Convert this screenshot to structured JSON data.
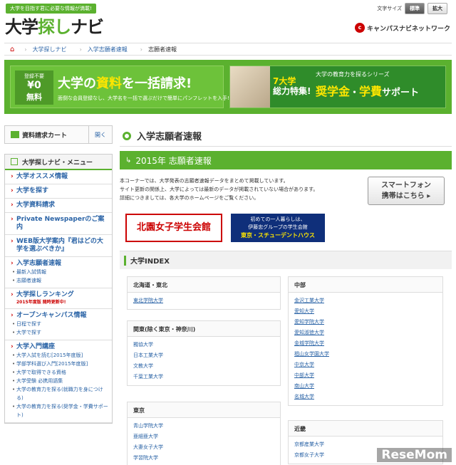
{
  "header": {
    "tagline": "大学を目指す君に必要な情報が満載!",
    "logo_prefix": "大学",
    "logo_mid": "探し",
    "logo_suffix": "ナビ",
    "font_size_label": "文字サイズ",
    "font_standard": "標準",
    "font_large": "拡大",
    "network": "キャンパスナビネットワーク"
  },
  "breadcrumb": {
    "items": [
      "大学探しナビ",
      "入学志願者速報",
      "志願者速報"
    ]
  },
  "banner": {
    "registration": "登録不要",
    "price": "¥0",
    "free": "無料",
    "headline_a": "大学の",
    "headline_b": "資料",
    "headline_c": "を一括請求!",
    "sub": "面倒な会員登録なし、大学名を一括で選ぶだけで簡単にパンフレットを入手!",
    "feature_a": "7大学",
    "feature_b": "総力特集!",
    "series": "大学の教育力を探るシリーズ",
    "scholar_a": "奨学金",
    "scholar_dot": "・",
    "scholar_b": "学費",
    "scholar_c": "サポート"
  },
  "sidebar": {
    "cart_label": "資料請求カート",
    "cart_open": "開く",
    "menu_title": "大学探しナビ・メニュー",
    "groups": [
      {
        "title": "大学オススメ情報"
      },
      {
        "title": "大学を探す"
      },
      {
        "title": "大学資料請求"
      },
      {
        "title": "Private Newspaperのご案内"
      },
      {
        "title": "WEB版大学案内『君はどの大学を選ぶべきか』"
      },
      {
        "title": "入学志願者速報",
        "subs": [
          "最新入試情報",
          "志願者速報"
        ]
      },
      {
        "title": "大学探しランキング",
        "note": "2015年度版 随時更新中!"
      },
      {
        "title": "オープンキャンパス情報",
        "subs": [
          "日程で探す",
          "大学で探す"
        ]
      },
      {
        "title": "大学入門講座",
        "subs": [
          "大学入試を読む[2015年度版]",
          "学部学科選び入門[2015年度版]",
          "大学で取得できる資格",
          "大学受験 必携用語集",
          "大学の教育力を探る(就職力を身につける)",
          "大学の教育力を探る(奨学金・学費サポート)"
        ]
      }
    ]
  },
  "main": {
    "page_title": "入学志願者速報",
    "section_title": "2015年 志願者速報",
    "intro": [
      "本コーナーでは、大学発表の志願者速報データをまとめて掲載しています。",
      "サイト更新の関係上、大学によっては最新のデータが掲載されていない場合があります。",
      "詳細につきましては、各大学のホームページをご覧ください。"
    ],
    "smartphone_line1": "スマートフォン",
    "smartphone_line2": "携帯はこちら",
    "ad1": "北園女子学生会館",
    "ad2_line1": "初めての一人暮らしは、",
    "ad2_line2": "伊藤忠グループの学生会館",
    "ad2_line3": "東京・スチューデントハウス",
    "index_title": "大学INDEX",
    "regions": [
      {
        "name": "北海道・東北",
        "items": [
          "東北学院大学"
        ]
      },
      {
        "name": "関東(除く東京・神奈川)",
        "items": [
          "獨協大学",
          "日本工業大学",
          "文教大学",
          "千葉工業大学"
        ]
      },
      {
        "name": "東京",
        "items": [
          "青山学院大学",
          "亜細亜大学",
          "大妻女子大学",
          "学習院大学"
        ]
      },
      {
        "name": "中部",
        "items": [
          "金沢工業大学",
          "愛知大学",
          "愛知学院大学",
          "愛知淑徳大学",
          "金城学院大学",
          "椙山女学園大学",
          "中京大学",
          "中部大学",
          "南山大学",
          "名城大学"
        ]
      },
      {
        "name": "近畿",
        "items": [
          "京都産業大学",
          "京都女子大学"
        ]
      }
    ]
  },
  "watermark": "ReseMom"
}
